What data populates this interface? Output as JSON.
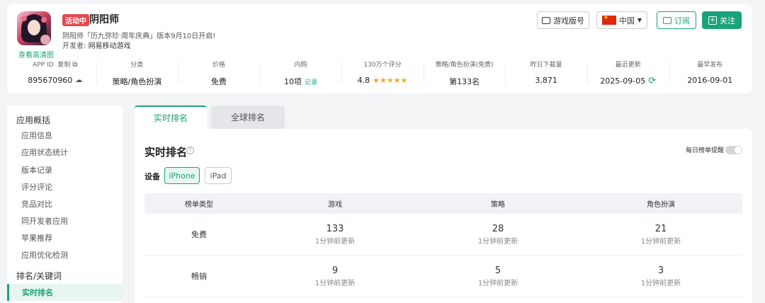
{
  "header": {
    "hd_link": "查看高清图",
    "active_tag": "活动中",
    "app_name": "阴阳师",
    "description": "阴阳师「历九弥珍·周年庆典」版本9月10日开启!",
    "developer_label": "开发者:",
    "developer": "网易移动游戏",
    "buttons": {
      "version": "游戏版号",
      "country": "中国",
      "subscribe": "订阅",
      "follow": "关注"
    },
    "stats": [
      {
        "label": "APP ID",
        "extra": "复制",
        "value": "895670960"
      },
      {
        "label": "分类",
        "value": "策略/角色扮演"
      },
      {
        "label": "价格",
        "value": "免费"
      },
      {
        "label": "内购",
        "value": "10项",
        "link": "记录"
      },
      {
        "label": "130万个评分",
        "value": "4.8",
        "stars": "★★★★★"
      },
      {
        "label": "策略/角色扮演(免费)",
        "value": "第133名"
      },
      {
        "label": "昨日下载量",
        "value": "3,871"
      },
      {
        "label": "最近更新",
        "value": "2025-09-05"
      },
      {
        "label": "最早发布",
        "value": "2016-09-01"
      }
    ],
    "rating_value": 4.8
  },
  "sidebar": {
    "group1": "应用概括",
    "items1": [
      "应用信息",
      "应用状态统计",
      "版本记录",
      "评分评论",
      "竞品对比",
      "同开发者应用",
      "苹果推荐",
      "应用优化检测"
    ],
    "group2": "排名/关键词",
    "active_item": "实时排名"
  },
  "tabs": [
    "实时排名",
    "全球排名"
  ],
  "panel": {
    "title": "实时排名",
    "remind_label": "每日榜单提醒",
    "device_label": "设备",
    "devices": [
      "iPhone",
      "iPad"
    ],
    "table": {
      "headers": [
        "榜单类型",
        "游戏",
        "策略",
        "角色扮演"
      ],
      "rows": [
        {
          "type": "免费",
          "cells": [
            {
              "rank": "133",
              "note": "1分钟前更新"
            },
            {
              "rank": "28",
              "note": "1分钟前更新"
            },
            {
              "rank": "21",
              "note": "1分钟前更新"
            }
          ]
        },
        {
          "type": "畅销",
          "cells": [
            {
              "rank": "9",
              "note": "1分钟前更新"
            },
            {
              "rank": "5",
              "note": "1分钟前更新"
            },
            {
              "rank": "3",
              "note": "1分钟前更新"
            }
          ]
        }
      ]
    }
  },
  "colors": {
    "accent": "#1aa37a",
    "tag": "#e5484d",
    "star": "#f5a623"
  }
}
